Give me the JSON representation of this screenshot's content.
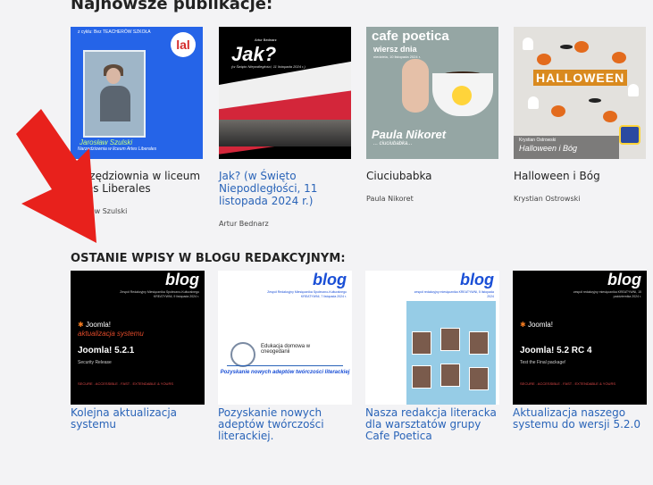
{
  "sections": {
    "publications_title": "Najnowsze publikacje:",
    "blog_title": "OSTANIE WPISY W BLOGU REDAKCYJNYM:"
  },
  "publications": [
    {
      "title": "Narzędziownia w liceum Artes Liberales",
      "author": "Jarosław Szulski",
      "linked": false,
      "thumb": {
        "top_label": "z cyklu: Bez TEACHERÓW SZKOŁA",
        "logo": "lal",
        "name": "Jarosław Szulski",
        "subtitle": "Narzędziownia w liceum Artes Liberales"
      }
    },
    {
      "title": "Jak? (w Święto Niepodległości, 11 listopada 2024 r.)",
      "author": "Artur Bednarz",
      "linked": true,
      "thumb": {
        "by": "Artur Bednarz",
        "headline": "Jak?",
        "subtitle": "(w Święto Niepodległości, 11 listopada 2024 r.)"
      }
    },
    {
      "title": "Ciuciubabka",
      "author": "Paula Nikoret",
      "linked": false,
      "thumb": {
        "header": "cafe poetica",
        "subheader": "wiersz dnia",
        "date": "niedziela, 10 listopada 2024 r.",
        "name": "Paula Nikoret",
        "subtitle": "... ciuciubabka..."
      }
    },
    {
      "title": "Halloween i Bóg",
      "author": "Krystian Ostrowski",
      "linked": false,
      "thumb": {
        "banner": "HALLOWEEN",
        "line1": "Krystian Ostrowski",
        "line2": "Halloween i Bóg"
      }
    }
  ],
  "blog_posts": [
    {
      "title": "Kolejna aktualizacja systemu",
      "thumb": {
        "word": "blog",
        "sub": "Zespół Redakcyjny Miesięcznika Społeczno-Kulturalnego KREATYWNI, 9 listopada 2024 r.",
        "logo": "Joomla!",
        "orange": "aktualizacja systemu",
        "big": "Joomla! 5.2.1",
        "small": "Security Release",
        "red": "SECURE . ACCESSIBLE . FAST . EXTENDABLE & YOURS"
      }
    },
    {
      "title": "Pozyskanie nowych adeptów twórczości literackiej.",
      "thumb": {
        "word": "blog",
        "sub": "Zespół Redakcyjny Miesięcznika Społeczno-Kulturalnego KREATYWNI, 7 listopada 2024 r.",
        "ed": "Edukacja domowa w cneogedanii",
        "quote": "Pozyskanie nowych adeptów twórczości literackiej"
      }
    },
    {
      "title": "Nasza redakcja literacka dla warsztatów grupy Cafe Poetica",
      "thumb": {
        "word": "blog",
        "sub": "zespół redakcyjny miesięcznika KREATYWNI, 5 listopada 2024"
      }
    },
    {
      "title": "Aktualizacja naszego systemu do wersji 5.2.0",
      "thumb": {
        "word": "blog",
        "sub": "zespół redakcyjny miesięcznika KREATYWNI, 15 października 2024 r.",
        "logo": "Joomla!",
        "big": "Joomla! 5.2 RC 4",
        "small": "Test the Final package!",
        "red": "SECURE . ACCESSIBLE . FAST . EXTENDABLE & YOURS"
      }
    }
  ],
  "colors": {
    "link": "#2a64b8",
    "arrow": "#e8211c",
    "background": "#f3f3f5"
  }
}
